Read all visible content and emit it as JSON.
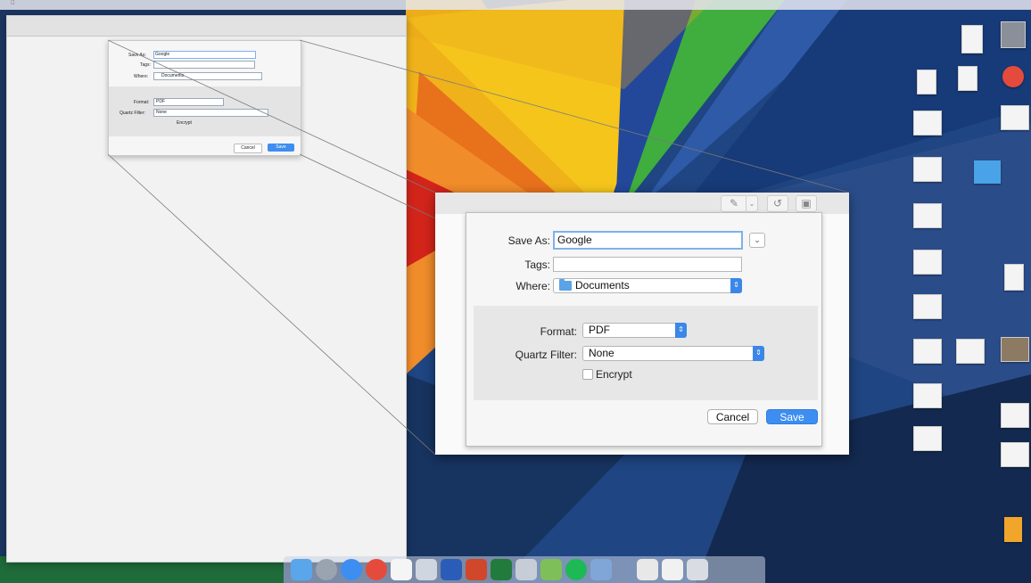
{
  "colors": {
    "accent_blue": "#3d8ef0",
    "focus_ring": "#7fb0ec",
    "dialog_bg": "#f6f6f6",
    "wall_blue": "#1e3f7a",
    "wall_yellow": "#f2b417",
    "wall_orange": "#ef7a1b",
    "wall_red": "#d8261c",
    "wall_green": "#4dbd3c"
  },
  "save_dialog": {
    "save_as_label": "Save As:",
    "save_as_value": "Google",
    "tags_label": "Tags:",
    "tags_value": "",
    "where_label": "Where:",
    "where_value": "Documents",
    "where_icon": "folder-icon",
    "format_label": "Format:",
    "format_value": "PDF",
    "quartz_filter_label": "Quartz Filter:",
    "quartz_filter_value": "None",
    "encrypt_label": "Encrypt",
    "encrypt_checked": false,
    "cancel_label": "Cancel",
    "save_label": "Save",
    "expand_icon": "chevron-down-icon"
  },
  "toolbar": {
    "icons": [
      "pen-icon",
      "chevron-down-icon",
      "rotate-icon",
      "briefcase-icon"
    ]
  },
  "dock_apps": [
    "finder-icon",
    "launchpad-icon",
    "safari-icon",
    "chrome-icon",
    "calendar-icon",
    "photos-icon",
    "word-icon",
    "powerpoint-icon",
    "excel-icon",
    "preview-icon",
    "messages-icon",
    "spotify-icon",
    "mail-icon",
    "app-icon",
    "documents-icon",
    "trash-icon"
  ]
}
